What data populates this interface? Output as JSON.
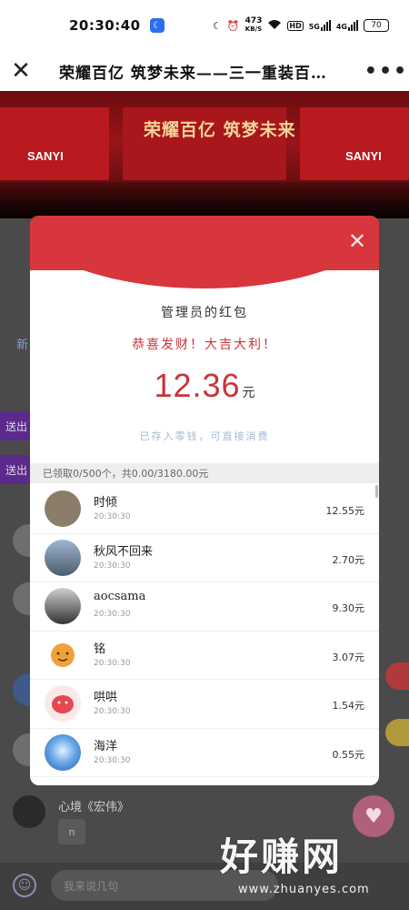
{
  "status_bar": {
    "time": "20:30:40",
    "speed_value": "473",
    "speed_unit": "KB/S",
    "hd": "HD",
    "net1": "5G",
    "net2": "4G",
    "battery": "70"
  },
  "nav": {
    "title": "荣耀百亿 筑梦未来——三一重装百…",
    "close_icon": "close-icon",
    "more_icon": "more-icon"
  },
  "banner": {
    "logo_left": "SANYI",
    "logo_right": "SANYI",
    "slogan": "荣耀百亿 筑梦未来"
  },
  "background": {
    "tag1": "送出",
    "tag2": "送出",
    "tab": "新",
    "name": "心境《宏伟》",
    "bubble": "n",
    "input_placeholder": "我来说几句"
  },
  "red_packet": {
    "sender": "管理员的红包",
    "greeting": "恭喜发财！大吉大利！",
    "amount": "12.36",
    "unit": "元",
    "note": "已存入零钱，可直接消费",
    "summary": "已领取0/500个，共0.00/3180.00元",
    "claims": [
      {
        "name": "时倾",
        "time": "20:30:30",
        "amount": "12.55元"
      },
      {
        "name": "秋风不回来",
        "time": "20:30:30",
        "amount": "2.70元"
      },
      {
        "name": "aocsama",
        "time": "20:30:30",
        "amount": "9.30元"
      },
      {
        "name": "铭",
        "time": "20:30:30",
        "amount": "3.07元"
      },
      {
        "name": "哄哄",
        "time": "20:30:30",
        "amount": "1.54元"
      },
      {
        "name": "海洋",
        "time": "20:30:30",
        "amount": "0.55元"
      }
    ]
  },
  "watermark": {
    "main": "好赚网",
    "sub": "www.zhuanyes.com"
  },
  "colors": {
    "accent_red": "#d6363c",
    "amount_red": "#c7353a",
    "note_blue": "#a8b8d4"
  }
}
